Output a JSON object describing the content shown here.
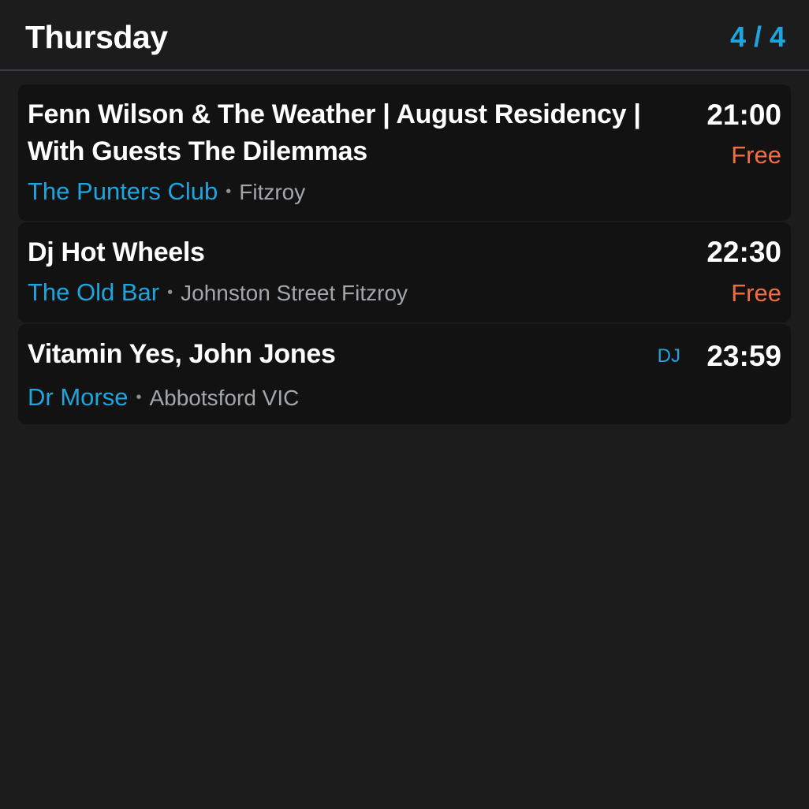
{
  "header": {
    "day": "Thursday",
    "page_count": "4 / 4"
  },
  "events": [
    {
      "title": "Fenn Wilson & The Weather | August Residency | With Guests The Dilemmas",
      "venue": "The Punters Club",
      "separator": "•",
      "location": "Fitzroy",
      "time": "21:00",
      "price": "Free"
    },
    {
      "title": "Dj Hot Wheels",
      "venue": "The Old Bar",
      "separator": "•",
      "location": "Johnston Street Fitzroy",
      "time": "22:30",
      "price": "Free"
    },
    {
      "title": "Vitamin Yes, John Jones",
      "venue": "Dr Morse",
      "separator": "•",
      "location": "Abbotsford VIC",
      "time": "23:59",
      "genre": "DJ"
    }
  ],
  "colors": {
    "background": "#1c1c1c",
    "card": "#121212",
    "accent": "#1ea5de",
    "price": "#f26c44",
    "secondary_text": "#a3a6ab"
  }
}
